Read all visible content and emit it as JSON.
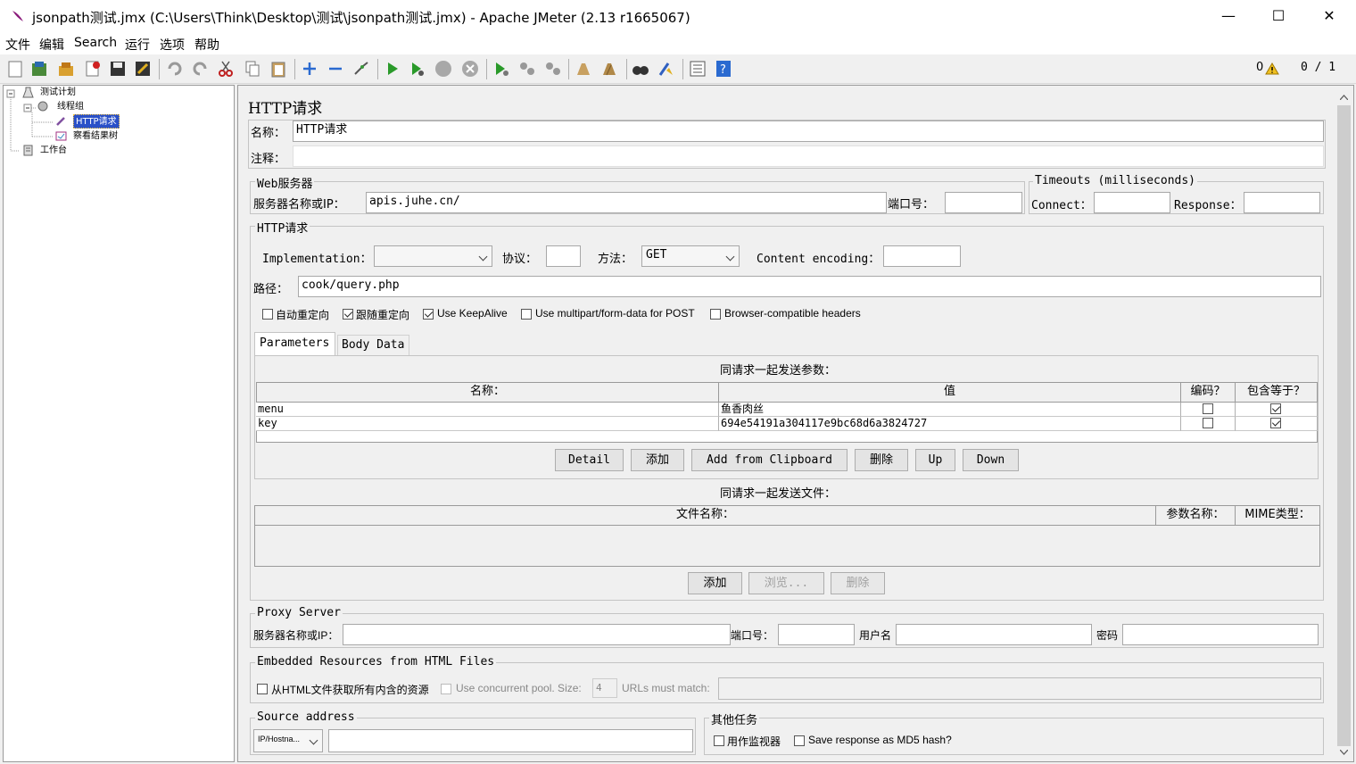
{
  "window": {
    "title": "jsonpath测试.jmx (C:\\Users\\Think\\Desktop\\测试\\jsonpath测试.jmx) - Apache JMeter (2.13 r1665067)",
    "minimize": "—",
    "maximize": "☐",
    "close": "✕"
  },
  "menu": [
    "文件",
    "编辑",
    "Search",
    "运行",
    "选项",
    "帮助"
  ],
  "status": {
    "warnings": "0",
    "threads": "0 / 1"
  },
  "tree": {
    "plan": "测试计划",
    "thread_group": "线程组",
    "http_request": "HTTP请求",
    "result_tree": "察看结果树",
    "workbench": "工作台"
  },
  "panel": {
    "title": "HTTP请求",
    "name_label": "名称：",
    "name_value": "HTTP请求",
    "comment_label": "注释："
  },
  "web_server": {
    "legend": "Web服务器",
    "server_label": "服务器名称或IP：",
    "server_value": "apis.juhe.cn/",
    "port_label": "端口号：",
    "port_value": ""
  },
  "timeouts": {
    "legend": "Timeouts (milliseconds)",
    "connect_label": "Connect：",
    "response_label": "Response："
  },
  "http_request": {
    "legend": "HTTP请求",
    "impl_label": "Implementation：",
    "impl_value": "",
    "protocol_label": "协议：",
    "protocol_value": "",
    "method_label": "方法：",
    "method_value": "GET",
    "encoding_label": "Content encoding：",
    "encoding_value": "",
    "path_label": "路径：",
    "path_value": "cook/query.php"
  },
  "options": {
    "auto_redirect": "自动重定向",
    "follow_redirect": "跟随重定向",
    "keepalive": "Use KeepAlive",
    "multipart": "Use multipart/form-data for POST",
    "browser_headers": "Browser-compatible headers"
  },
  "tabs": [
    "Parameters",
    "Body Data"
  ],
  "params": {
    "caption": "同请求一起发送参数：",
    "columns": [
      "名称：",
      "值",
      "编码？",
      "包含等于？"
    ],
    "rows": [
      {
        "name": "menu",
        "value": "鱼香肉丝",
        "encode": false,
        "include_equals": true
      },
      {
        "name": "key",
        "value": "694e54191a304117e9bc68d6a3824727",
        "encode": false,
        "include_equals": true
      }
    ],
    "buttons": [
      "Detail",
      "添加",
      "Add from Clipboard",
      "删除",
      "Up",
      "Down"
    ]
  },
  "files": {
    "caption": "同请求一起发送文件：",
    "columns": [
      "文件名称：",
      "参数名称：",
      "MIME类型："
    ],
    "buttons": [
      "添加",
      "浏览...",
      "删除"
    ]
  },
  "proxy": {
    "legend": "Proxy Server",
    "server_label": "服务器名称或IP：",
    "port_label": "端口号：",
    "user_label": "用户名",
    "password_label": "密码"
  },
  "embedded": {
    "legend": "Embedded Resources from HTML Files",
    "fetch_label": "从HTML文件获取所有内含的资源",
    "pool_label": "Use concurrent pool. Size:",
    "pool_size": "4",
    "urls_label": "URLs must match:"
  },
  "source": {
    "legend": "Source address",
    "type_value": "IP/Hostna..."
  },
  "other_tasks": {
    "legend": "其他任务",
    "monitor_label": "用作监视器",
    "md5_label": "Save response as MD5 hash?"
  }
}
